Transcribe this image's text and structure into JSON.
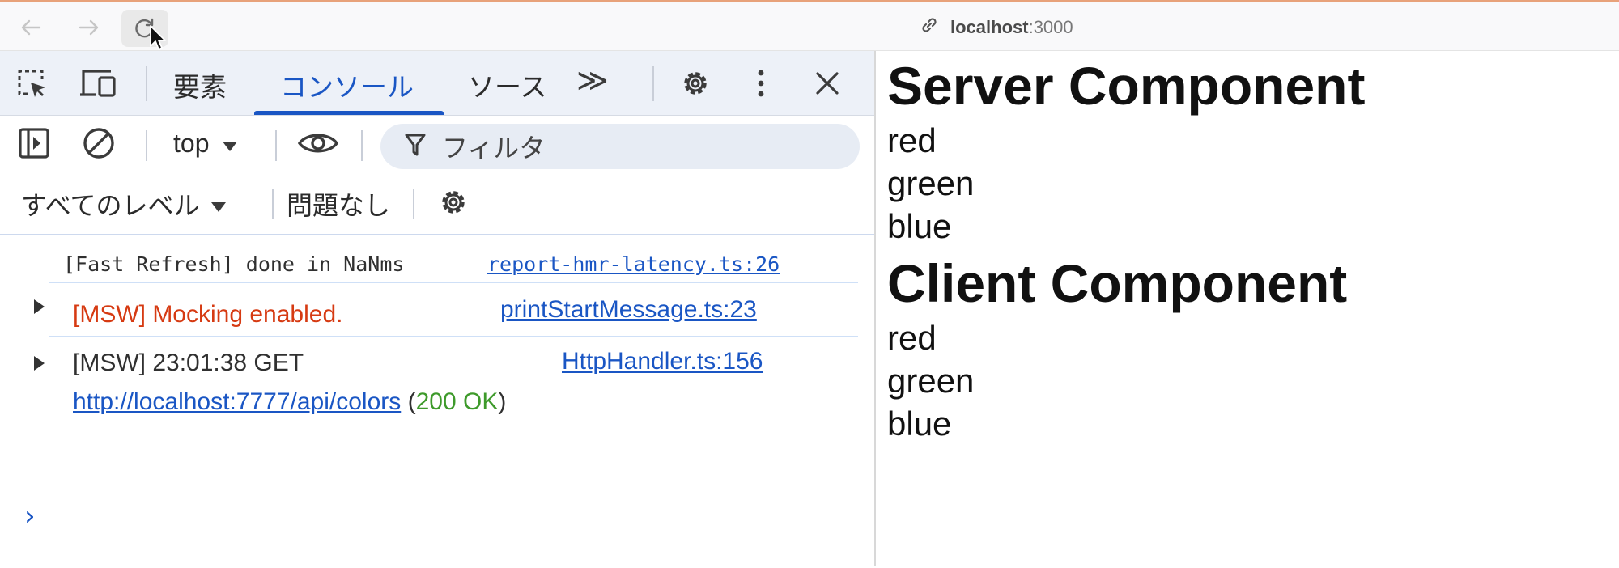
{
  "browser": {
    "address": {
      "host": "localhost",
      "port": ":3000"
    }
  },
  "devtools": {
    "tabs": [
      {
        "label": "要素"
      },
      {
        "label": "コンソール"
      },
      {
        "label": "ソース"
      }
    ],
    "more_tabs_label": "≫",
    "context": "top",
    "filter_placeholder": "フィルタ",
    "levels_label": "すべてのレベル",
    "issues_label": "問題なし"
  },
  "console": {
    "messages": [
      {
        "text": "[Fast Refresh] done in NaNms",
        "source": "report-hmr-latency.ts:26"
      },
      {
        "text": "[MSW] Mocking enabled.",
        "source": "printStartMessage.ts:23",
        "color": "#d63a12"
      },
      {
        "text": "[MSW] 23:01:38 GET",
        "source": "HttpHandler.ts:156",
        "url": "http://localhost:7777/api/colors",
        "status": "200 OK",
        "open_paren": "(",
        "close_paren": ")"
      }
    ],
    "prompt": "›"
  },
  "page": {
    "server_heading": "Server Component",
    "server_items": [
      "red",
      "green",
      "blue"
    ],
    "client_heading": "Client Component",
    "client_items": [
      "red",
      "green",
      "blue"
    ]
  },
  "colors": {
    "accent": "#1a56c4",
    "error_text": "#d63a12",
    "status_ok": "#3e9a2b"
  },
  "icons": [
    "back-arrow-icon",
    "forward-arrow-icon",
    "reload-icon",
    "mouse-cursor-icon",
    "link-icon",
    "inspect-element-icon",
    "device-toolbar-icon",
    "chevron-double-right-icon",
    "gear-icon",
    "kebab-menu-icon",
    "close-icon",
    "sidebar-toggle-icon",
    "clear-console-icon",
    "dropdown-triangle-icon",
    "eye-icon",
    "filter-funnel-icon",
    "expand-triangle-icon"
  ]
}
